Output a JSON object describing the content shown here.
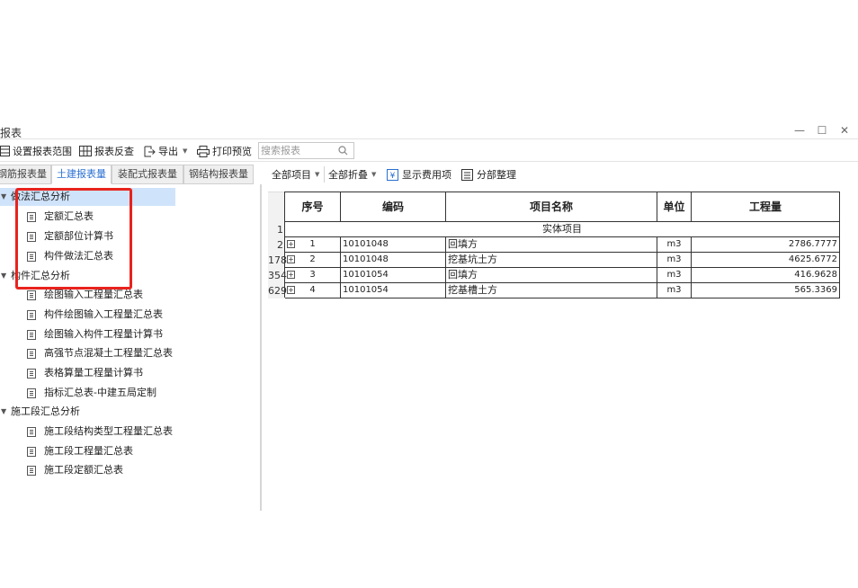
{
  "window": {
    "title": "报表",
    "controls": {
      "minimize": "—",
      "maximize": "☐",
      "close": "✕"
    }
  },
  "toolbar": {
    "set_range": "设置报表范围",
    "reverse_check": "报表反查",
    "export": "导出",
    "print_preview": "打印预览",
    "search_placeholder": "搜索报表"
  },
  "tabs": [
    {
      "label": "钢筋报表量",
      "active": false
    },
    {
      "label": "土建报表量",
      "active": true
    },
    {
      "label": "装配式报表量",
      "active": false
    },
    {
      "label": "钢结构报表量",
      "active": false
    }
  ],
  "tree": {
    "groups": [
      {
        "label": "做法汇总分析",
        "items": [
          "定额汇总表",
          "定额部位计算书",
          "构件做法汇总表"
        ]
      },
      {
        "label": "构件汇总分析",
        "items": [
          "绘图输入工程量汇总表",
          "构件绘图输入工程量汇总表",
          "绘图输入构件工程量计算书",
          "高强节点混凝土工程量汇总表",
          "表格算量工程量计算书",
          "指标汇总表-中建五局定制"
        ]
      },
      {
        "label": "施工段汇总分析",
        "items": [
          "施工段结构类型工程量汇总表",
          "施工段工程量汇总表",
          "施工段定额汇总表"
        ]
      }
    ]
  },
  "right_toolbar": {
    "all_items": "全部项目",
    "all_collapse": "全部折叠",
    "show_fees": "显示费用项",
    "section_arrange": "分部整理"
  },
  "table": {
    "headers": [
      "序号",
      "编码",
      "项目名称",
      "单位",
      "工程量"
    ],
    "group_row": {
      "rownum": "1",
      "label": "实体项目"
    },
    "rows": [
      {
        "rownum": "2",
        "seq": "1",
        "code": "10101048",
        "name": "回填方",
        "unit": "m3",
        "qty": "2786.7777"
      },
      {
        "rownum": "178",
        "seq": "2",
        "code": "10101048",
        "name": "挖基坑土方",
        "unit": "m3",
        "qty": "4625.6772"
      },
      {
        "rownum": "354",
        "seq": "3",
        "code": "10101054",
        "name": "回填方",
        "unit": "m3",
        "qty": "416.9628"
      },
      {
        "rownum": "629",
        "seq": "4",
        "code": "10101054",
        "name": "挖基槽土方",
        "unit": "m3",
        "qty": "565.3369"
      }
    ]
  },
  "colors": {
    "highlight": "#e8231d",
    "accent": "#2a6fd1",
    "selected": "#cfe3fa"
  }
}
